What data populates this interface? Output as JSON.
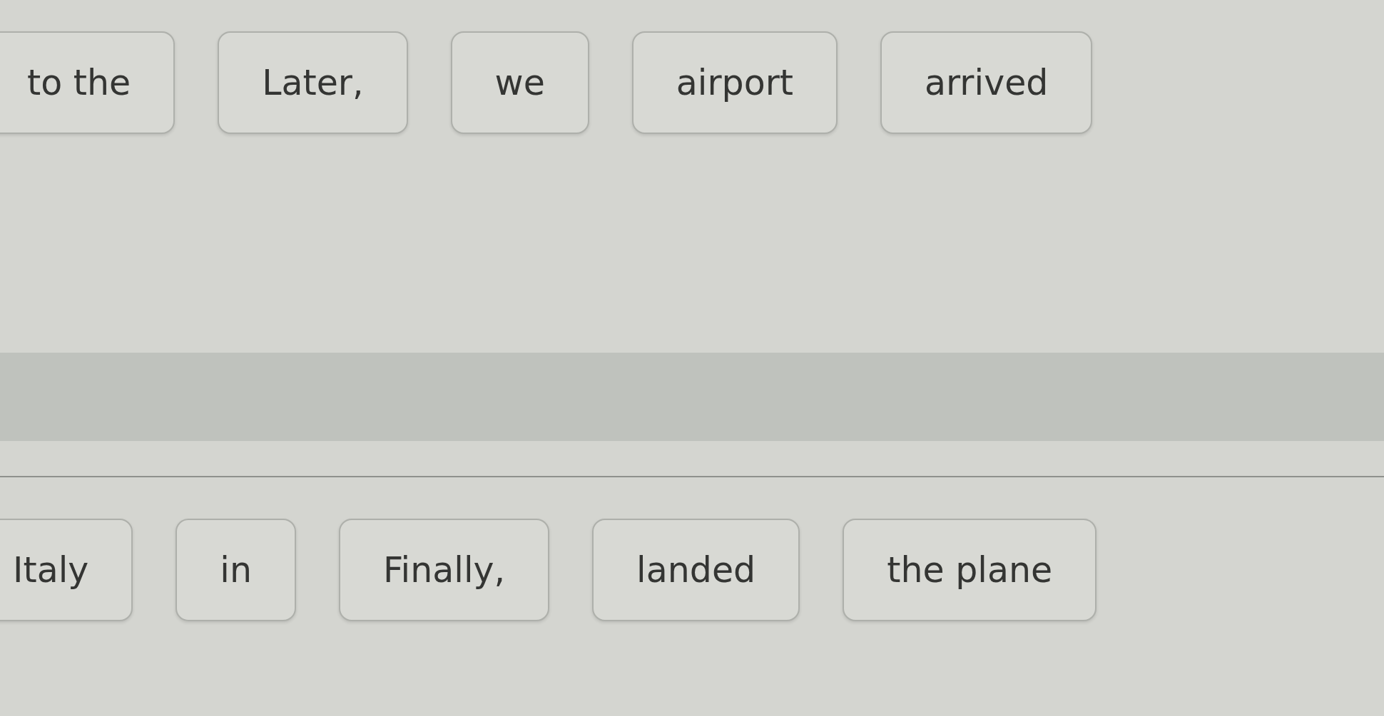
{
  "top_row": {
    "tiles": [
      "to the",
      "Later,",
      "we",
      "airport",
      "arrived"
    ]
  },
  "bottom_row": {
    "tiles": [
      "Italy",
      "in",
      "Finally,",
      "landed",
      "the plane"
    ]
  }
}
